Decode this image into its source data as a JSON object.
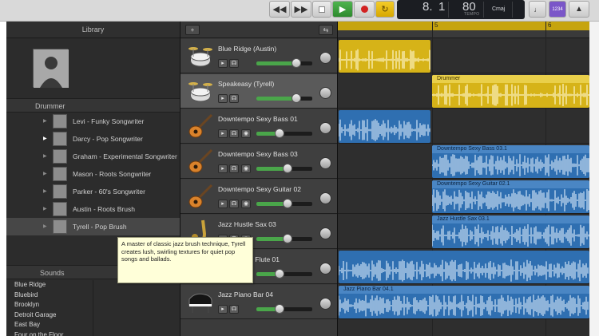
{
  "transport": {
    "rewind_icon": "rewind-icon",
    "forward_icon": "fast-forward-icon",
    "stop_icon": "stop-icon",
    "play_icon": "play-icon",
    "record_icon": "record-icon",
    "cycle_icon": "cycle-icon",
    "lcd": {
      "bar": "8.",
      "beat": "1",
      "tempo": "80",
      "tempo_label": "TEMPO",
      "key": "Cmaj"
    },
    "time_label": "1234"
  },
  "library": {
    "title": "Library",
    "drummer_section": "Drummer",
    "drummers": [
      {
        "name": "Levi - Funky Songwriter",
        "selected": false
      },
      {
        "name": "Darcy - Pop Songwriter",
        "selected": false
      },
      {
        "name": "Graham - Experimental Songwriter",
        "selected": false
      },
      {
        "name": "Mason - Roots Songwriter",
        "selected": false
      },
      {
        "name": "Parker - 60's Songwriter",
        "selected": false
      },
      {
        "name": "Austin - Roots Brush",
        "selected": false
      },
      {
        "name": "Tyrell - Pop Brush",
        "selected": true
      }
    ],
    "sounds_section": "Sounds",
    "sounds": [
      "Blue Ridge",
      "Bluebird",
      "Brooklyn",
      "Detroit Garage",
      "East Bay",
      "Four on the Floor"
    ]
  },
  "tooltip": {
    "text": "A master of classic jazz brush technique, Tyrell creates lush, swirling textures for quiet pop songs and ballads."
  },
  "tracks": [
    {
      "name": "Blue Ridge (Austin)",
      "type": "drums",
      "volume": 0.72,
      "selected": false
    },
    {
      "name": "Speakeasy (Tyrell)",
      "type": "drums",
      "volume": 0.72,
      "selected": true
    },
    {
      "name": "Downtempo Sexy Bass 01",
      "type": "guitar",
      "volume": 0.42,
      "selected": false
    },
    {
      "name": "Downtempo Sexy Bass 03",
      "type": "guitar",
      "volume": 0.55,
      "selected": false
    },
    {
      "name": "Downtempo Sexy Guitar 02",
      "type": "guitar",
      "volume": 0.55,
      "selected": false
    },
    {
      "name": "Jazz Hustle Sax 03",
      "type": "sax",
      "volume": 0.55,
      "selected": false
    },
    {
      "name": "Jazz Hustle Flute 01",
      "type": "flute",
      "volume": 0.42,
      "selected": false
    },
    {
      "name": "Jazz Piano Bar 04",
      "type": "piano",
      "volume": 0.42,
      "selected": false
    }
  ],
  "timeline": {
    "bar_markers": [
      "5",
      "6"
    ],
    "regions": [
      {
        "lane": 0,
        "label": "",
        "color": "gold",
        "start": 0.0,
        "end": 0.37
      },
      {
        "lane": 1,
        "label": "Drummer",
        "color": "gold",
        "start": 0.37,
        "end": 1.0
      },
      {
        "lane": 2,
        "label": "",
        "color": "blue",
        "start": 0.0,
        "end": 0.37
      },
      {
        "lane": 3,
        "label": "Downtempo Sexy Bass 03.1",
        "color": "blue",
        "start": 0.37,
        "end": 1.0
      },
      {
        "lane": 4,
        "label": "Downtempo Sexy Guitar 02.1",
        "color": "blue",
        "start": 0.37,
        "end": 1.0
      },
      {
        "lane": 5,
        "label": "Jazz Hustle Sax 03.1",
        "color": "blue",
        "start": 0.37,
        "end": 1.0
      },
      {
        "lane": 6,
        "label": "",
        "color": "blue",
        "start": 0.0,
        "end": 1.0
      },
      {
        "lane": 7,
        "label": "Jazz Piano Bar 04.1",
        "color": "blue",
        "start": 0.0,
        "end": 1.0
      }
    ]
  },
  "colors": {
    "gold_region": "#d6b318",
    "gold_header": "#e9cf4a",
    "blue_region": "#2f6fb1",
    "blue_header": "#4a86c4",
    "play_green": "#3a9a3a",
    "record_red": "#d22222",
    "cycle_yellow": "#e6b800"
  }
}
